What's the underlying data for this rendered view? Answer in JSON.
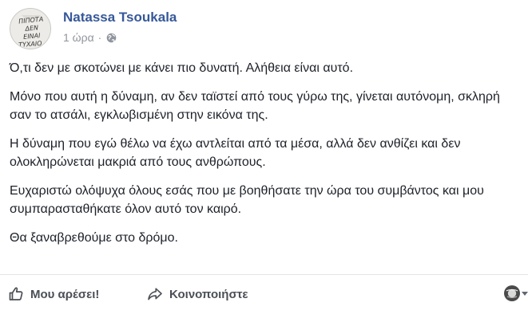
{
  "post": {
    "author": "Natassa Tsoukala",
    "time": "1 ώρα",
    "separator": "·",
    "privacy_icon": "globe-icon",
    "avatar_text": [
      "ΠΙΠΟΤΑ",
      "ΔΕΝ",
      "ΕΙΝΑΙ",
      "ΤΥΧΑΙΟ"
    ],
    "paragraphs": [
      "Ό,τι δεν με σκοτώνει με κάνει πιο δυνατή. Αλήθεια είναι αυτό.",
      "Μόνο που αυτή η δύναμη, αν δεν ταϊστεί από τους γύρω της, γίνεται αυτόνομη, σκληρή σαν το ατσάλι, εγκλωβισμένη στην εικόνα της.",
      "Η δύναμη που εγώ θέλω να έχω αντλείται από τα μέσα, αλλά δεν ανθίζει και δεν ολοκληρώνεται μακριά από τους ανθρώπους.",
      "Ευχαριστώ ολόψυχα όλους εσάς που με βοηθήσατε την ώρα του συμβάντος και μου συμπαρασταθήκατε όλον αυτό τον καιρό.",
      "Θα ξαναβρεθούμε στο δρόμο."
    ]
  },
  "actions": {
    "like_label": "Μου αρέσει!",
    "share_label": "Κοινοποιήστε",
    "like_icon": "thumbs-up-icon",
    "share_icon": "share-arrow-icon",
    "reaction_icon": "profile-avatar-icon"
  },
  "colors": {
    "author": "#365899",
    "meta": "#90949c",
    "text": "#1d2129",
    "action": "#4b4f56"
  }
}
